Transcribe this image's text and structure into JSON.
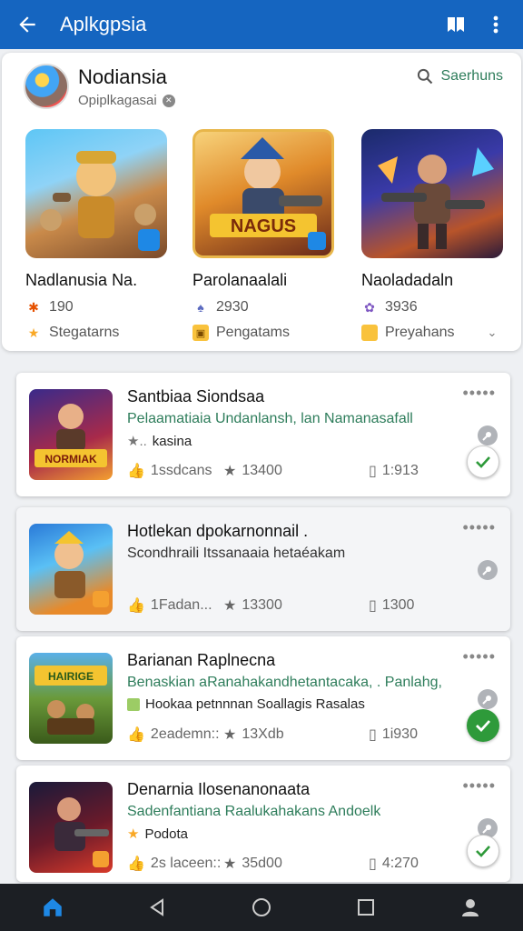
{
  "app_bar": {
    "title": "Aplkgpsia",
    "back_icon": "arrow-left-icon",
    "bookmark_icon": "bookmark-icon",
    "menu_icon": "more-vert-icon"
  },
  "featured": {
    "developer_name": "Nodiansia",
    "developer_sub": "Opiplkagasai",
    "search_label": "Saerhuns",
    "cards": [
      {
        "title": "Nadlanusia Na.",
        "stat": "190",
        "tag": "Stegatarns"
      },
      {
        "title": "Parolanaalali",
        "stat": "2930",
        "tag": "Pengatams",
        "art_text": "NAGUS"
      },
      {
        "title": "Naoladadaln",
        "stat": "3936",
        "tag": "Preyahans"
      }
    ]
  },
  "list": [
    {
      "title": "Santbiaa Siondsaa",
      "subtitle": "Pelaamatiaia Undanlansh, lan Namanasafall",
      "tag": "kasina",
      "likes": "1ssdcans",
      "rating": "13400",
      "files": "1:913",
      "check": "outline",
      "art_text": "NORMIAK"
    },
    {
      "title": "Hotlekan dpokarnonnail .",
      "subtitle": "Scondhraili Itssanaaia hetaéakam",
      "tag": "",
      "likes": "1Fadan...",
      "rating": "13300",
      "files": "1300",
      "check": "none"
    },
    {
      "title": "Barianan Raplnecna",
      "subtitle": "Benaskian aRanahakandhetantacaka, . Panlahg,",
      "tag": "Hookaa  petnnnan  Soallagis Rasalas",
      "likes": "2eademn::",
      "rating": "13Xdb",
      "files": "1i930",
      "check": "filled",
      "art_text": "HAIRIGE"
    },
    {
      "title": "Denarnia Ilosenanonaata",
      "subtitle": "Sadenfantiana Raalukahakans Andoelk",
      "tag": "Podota",
      "likes": "2s laceen::",
      "rating": "35d00",
      "files": "4:270",
      "check": "outline"
    }
  ],
  "nav": {
    "home_icon": "home-icon",
    "back_icon": "triangle-back-icon",
    "circle_icon": "circle-home-icon",
    "square_icon": "square-recents-icon",
    "profile_icon": "person-icon"
  },
  "colors": {
    "primary": "#1565c0",
    "accent_green": "#2e7d5b",
    "check_green": "#2e9a3a"
  }
}
